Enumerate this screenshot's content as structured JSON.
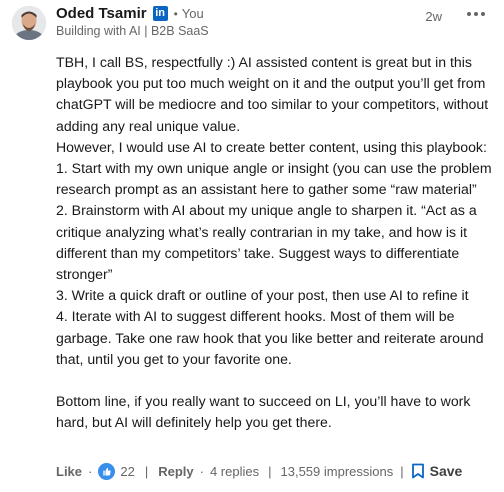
{
  "author": {
    "name": "Oded Tsamir",
    "badge": "in",
    "separator": "•",
    "relation": "You",
    "headline": "Building with AI | B2B SaaS"
  },
  "timestamp": "2w",
  "paragraphs": [
    "TBH, I call BS, respectfully :) AI assisted content is great but in this playbook you put too much weight on it and the output you’ll get from chatGPT will be mediocre and too similar to your competitors, without adding any real unique value.",
    "However, I would use AI to create better content, using this playbook:",
    "1. Start with my own unique angle or insight (you can use the problem research prompt as an assistant here to gather some “raw material”",
    "2. Brainstorm with AI about my unique angle to sharpen it. “Act as a critique analyzing what’s really contrarian in my take, and how is it different than my competitors’ take. Suggest ways to differentiate stronger”",
    "3. Write a quick draft or outline of your post, then use AI to refine it",
    "4. Iterate with AI to suggest different hooks. Most of them will be garbage. Take one raw hook that you like better and reiterate around that, until you get to your favorite one.",
    "",
    "Bottom line, if you really want to succeed on LI, you’ll have to work hard, but AI will definitely help you get there."
  ],
  "actions": {
    "like": "Like",
    "sep": "·",
    "reaction_count": "22",
    "divider": "|",
    "reply": "Reply",
    "replies": "4 replies",
    "impressions": "13,559 impressions",
    "save": "Save"
  },
  "colors": {
    "brand": "#0a66c2",
    "text": "#191919",
    "muted": "#666666"
  },
  "icons": [
    "more-options-icon",
    "like-reaction-icon",
    "bookmark-icon"
  ]
}
